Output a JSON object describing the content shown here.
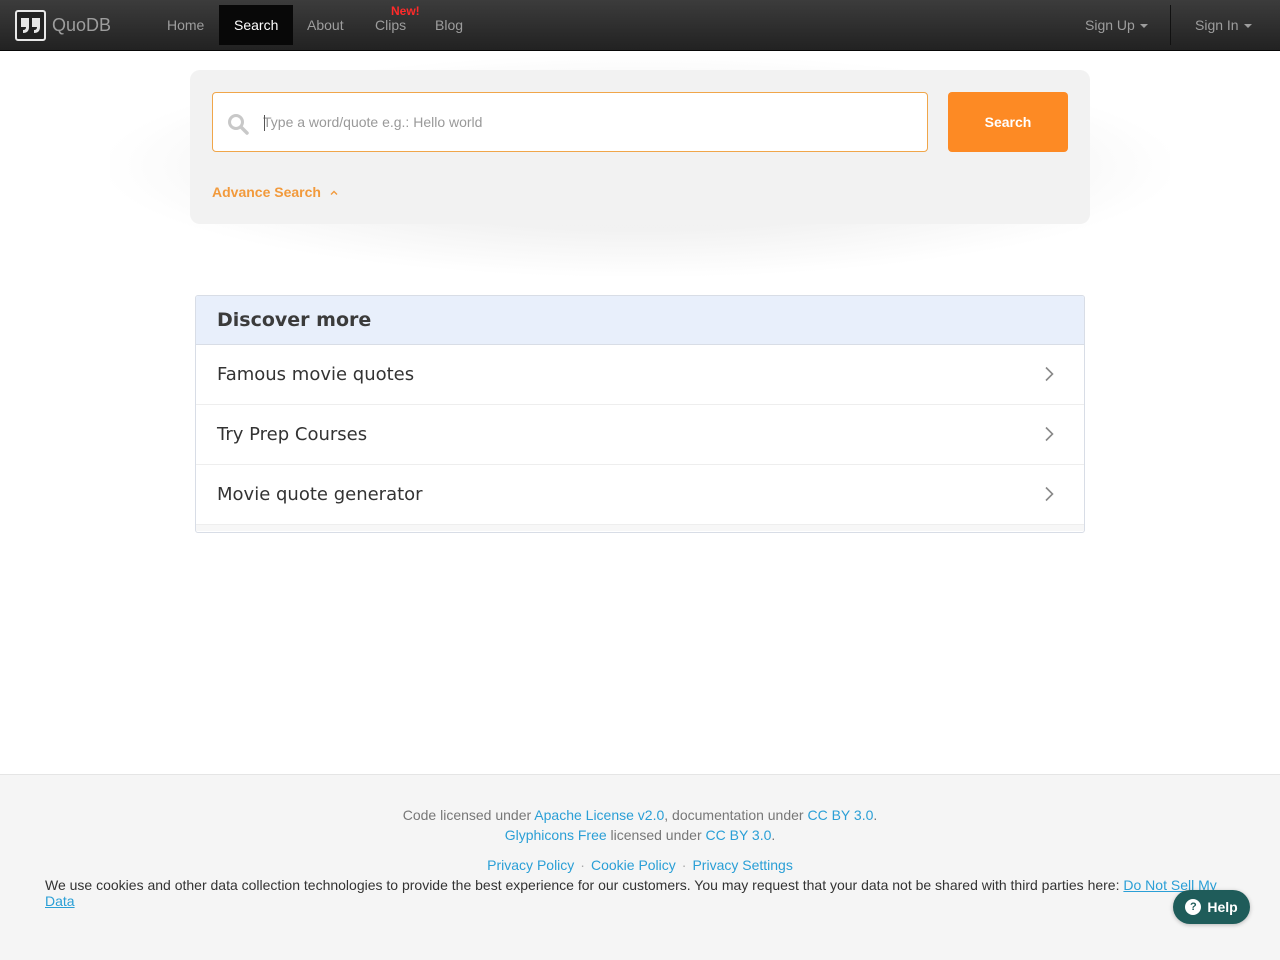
{
  "navbar": {
    "brand": "QuoDB",
    "links": [
      {
        "label": "Home",
        "active": false
      },
      {
        "label": "Search",
        "active": true
      },
      {
        "label": "About",
        "active": false
      },
      {
        "label": "Clips",
        "active": false
      },
      {
        "label": "Blog",
        "active": false
      }
    ],
    "new_badge": "New!",
    "sign_up": "Sign Up",
    "sign_in": "Sign In"
  },
  "search": {
    "placeholder": "Type a word/quote e.g.: Hello world",
    "value": "",
    "button_label": "Search",
    "advance_label": "Advance Search"
  },
  "discover": {
    "title": "Discover more",
    "items": [
      {
        "label": "Famous movie quotes"
      },
      {
        "label": "Try Prep Courses"
      },
      {
        "label": "Movie quote generator"
      }
    ]
  },
  "footer": {
    "code_prefix": "Code licensed under ",
    "code_license": "Apache License v2.0",
    "doc_prefix": ", documentation under ",
    "doc_license": "CC BY 3.0",
    "period1": ".",
    "glyphicons": "Glyphicons Free",
    "glyph_mid": " licensed under ",
    "glyph_license": "CC BY 3.0",
    "period2": ".",
    "links": [
      "Privacy Policy",
      "Cookie Policy",
      "Privacy Settings"
    ],
    "separator": "·",
    "cookie_text": "We use cookies and other data collection technologies to provide the best experience for our customers. You may request that your data not be shared with third parties here: ",
    "cookie_link": "Do Not Sell My Data"
  },
  "help": {
    "label": "Help"
  },
  "colors": {
    "accent": "#fd8a24",
    "link": "#2a9fd6",
    "navbar": "#222222",
    "new_badge": "#ff2a2a",
    "help": "#1f5c5a"
  }
}
